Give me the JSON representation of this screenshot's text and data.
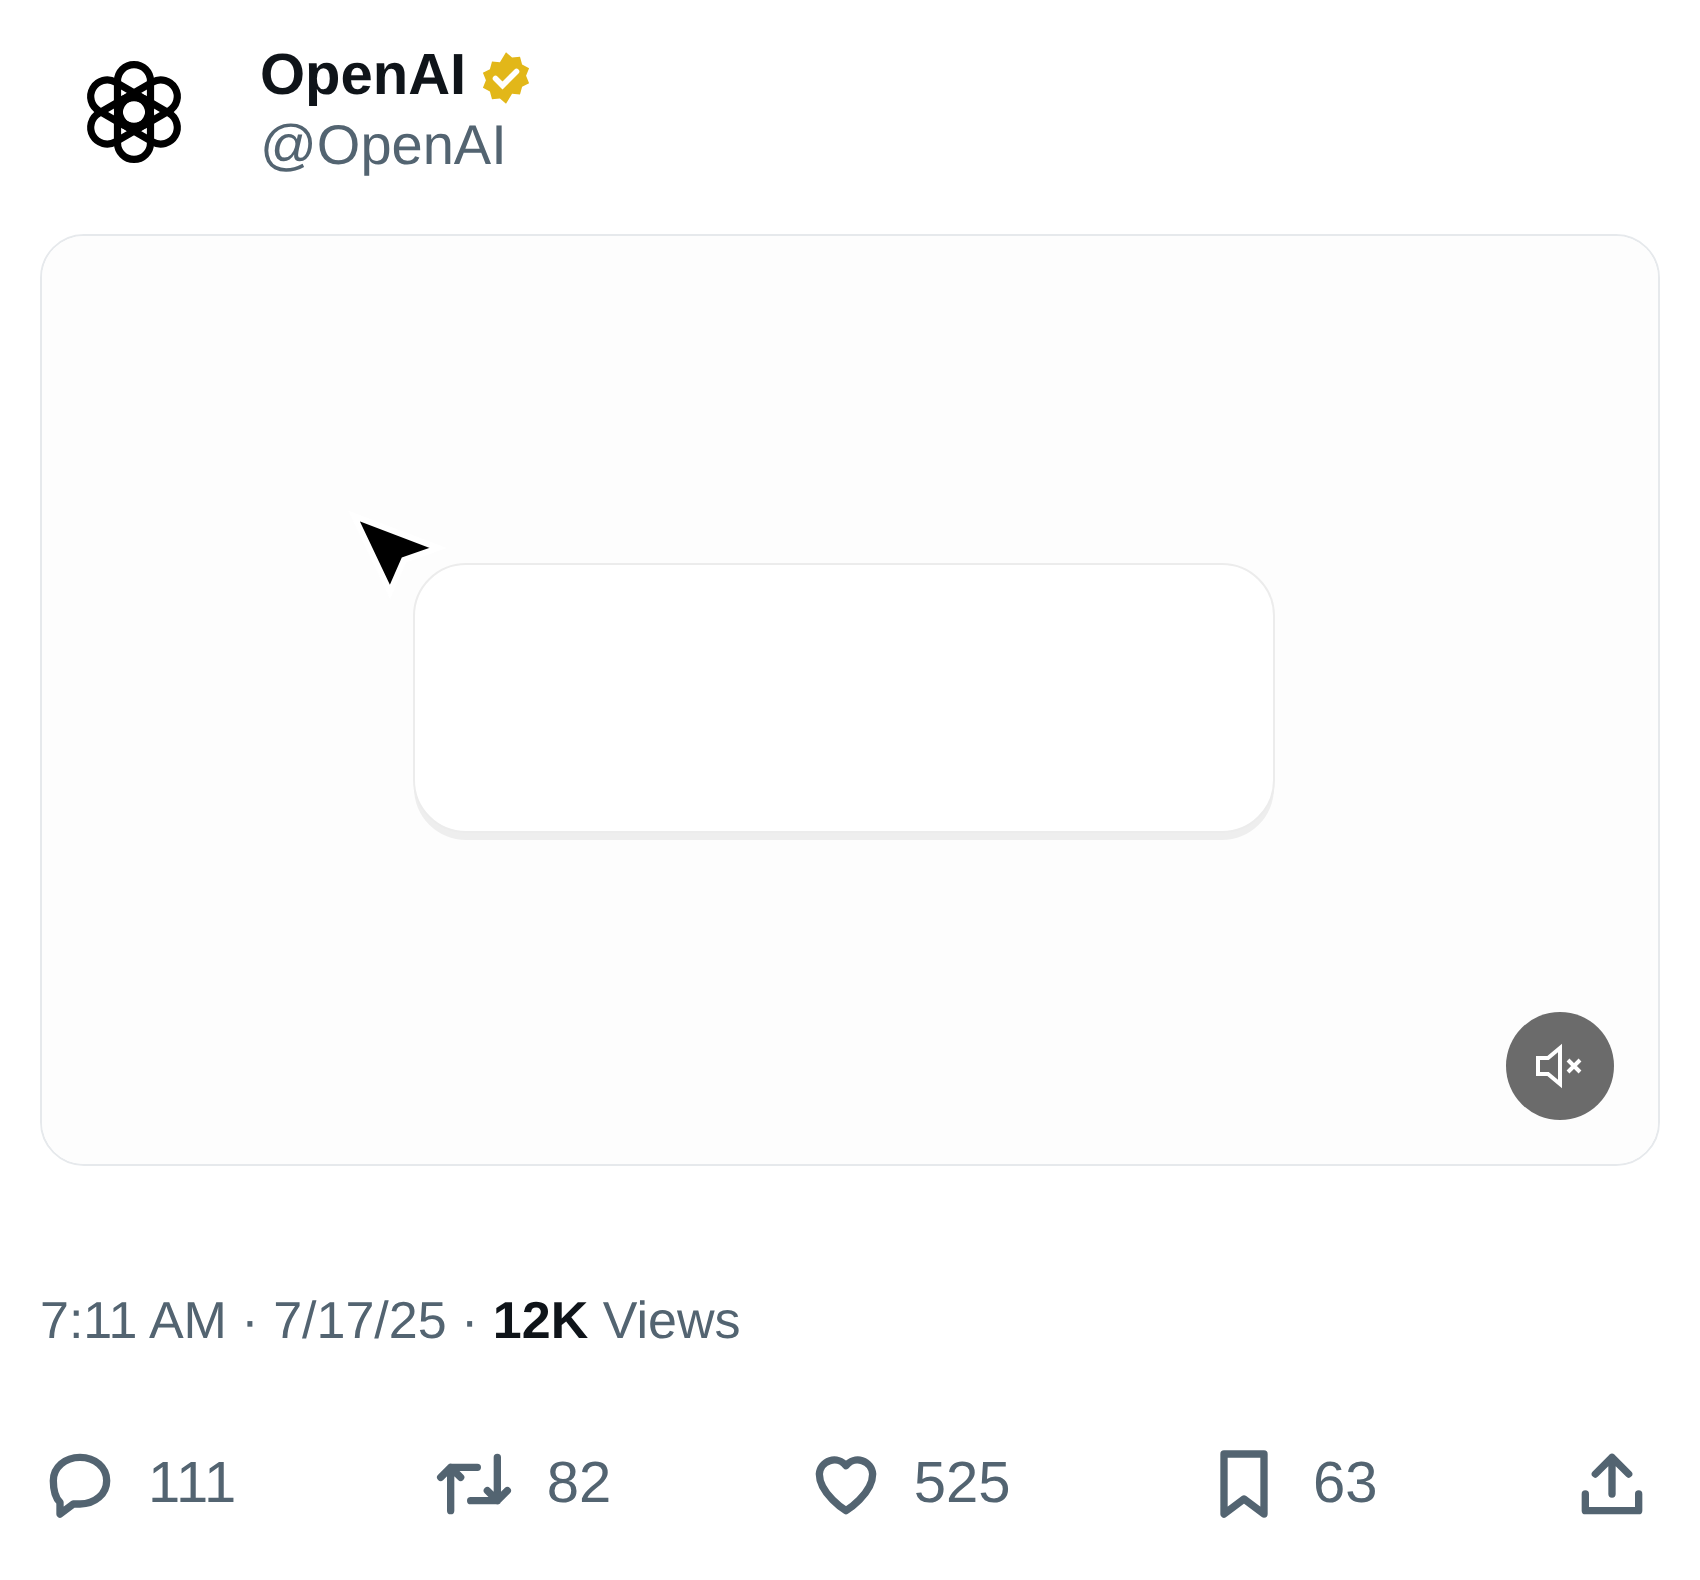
{
  "author": {
    "name": "OpenAI",
    "verified": true,
    "handle": "@OpenAI"
  },
  "media": {
    "kind": "picture",
    "muted": true
  },
  "meta": "7:11 AM · 7/17/25 · **12K** Views",
  "actions": [
    {
      "kind": "reply",
      "count": "111"
    },
    {
      "kind": "repost",
      "count": "82"
    },
    {
      "kind": "like",
      "count": "525"
    },
    {
      "kind": "bookmark",
      "count": "63"
    },
    {
      "kind": "share"
    }
  ]
}
